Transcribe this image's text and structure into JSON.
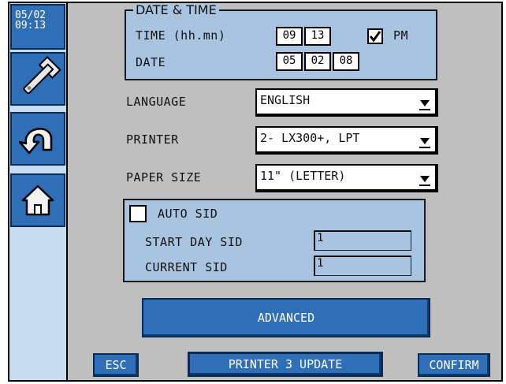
{
  "sidebar": {
    "clock_date": "05/02",
    "clock_time": "09:13",
    "items": [
      {
        "name": "wrench-icon"
      },
      {
        "name": "back-arrow-icon"
      },
      {
        "name": "home-icon"
      }
    ]
  },
  "datetime": {
    "title": "DATE & TIME",
    "time_label": "TIME (hh.mn)",
    "hour": "09",
    "minute": "13",
    "pm_checked": true,
    "pm_label": "PM",
    "date_label": "DATE",
    "day": "05",
    "month": "02",
    "year": "08"
  },
  "settings": {
    "language_label": "LANGUAGE",
    "language_value": "ENGLISH",
    "printer_label": "PRINTER",
    "printer_value": "2- LX300+, LPT",
    "paper_label": "PAPER SIZE",
    "paper_value": "11\" (LETTER)"
  },
  "sid": {
    "auto_label": "AUTO SID",
    "auto_checked": false,
    "start_label": "START DAY SID",
    "start_value": "1",
    "current_label": "CURRENT SID",
    "current_value": "1"
  },
  "buttons": {
    "advanced": "ADVANCED",
    "esc": "ESC",
    "printer_update": "PRINTER 3 UPDATE",
    "confirm": "CONFIRM"
  },
  "colors": {
    "accent": "#2e6fb8",
    "panel": "#a8c4e0",
    "background": "#bfbfbf",
    "sidebar": "#c6dcf0"
  }
}
